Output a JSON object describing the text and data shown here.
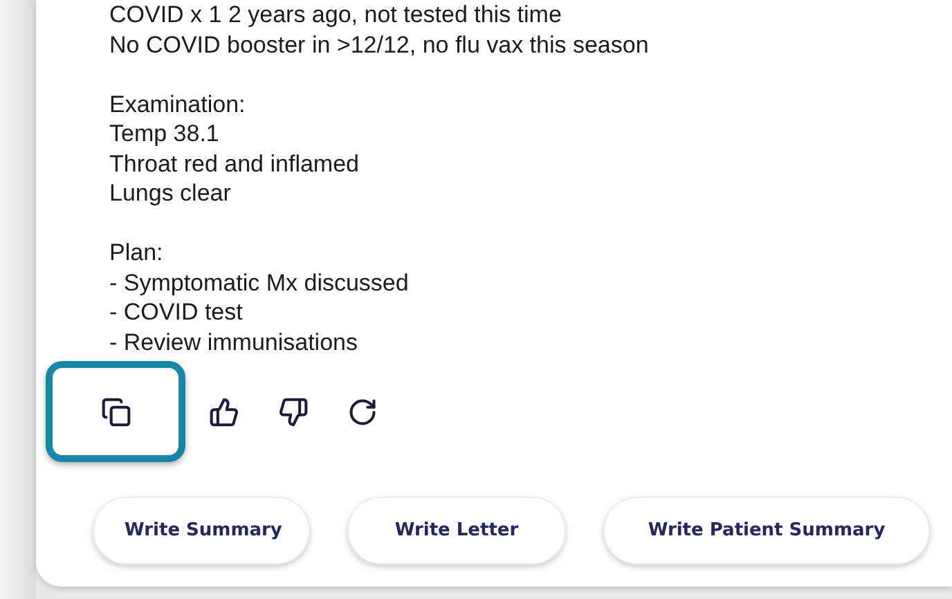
{
  "note": {
    "paragraphs": [
      {
        "lines": [
          "COVID x 1 2 years ago, not tested this time",
          "No COVID booster in >12/12, no flu vax this season"
        ]
      },
      {
        "lines": [
          "Examination:",
          "Temp 38.1",
          "Throat red and inflamed",
          "Lungs clear"
        ]
      },
      {
        "lines": [
          "Plan:",
          "- Symptomatic Mx discussed",
          "- COVID test",
          "- Review immunisations"
        ]
      }
    ]
  },
  "actions": [
    {
      "kind": "copy",
      "highlighted": true
    },
    {
      "kind": "like",
      "highlighted": false
    },
    {
      "kind": "dislike",
      "highlighted": false
    },
    {
      "kind": "regenerate",
      "highlighted": false
    }
  ],
  "buttons": [
    "Write Summary",
    "Write Letter",
    "Write Patient Summary"
  ]
}
